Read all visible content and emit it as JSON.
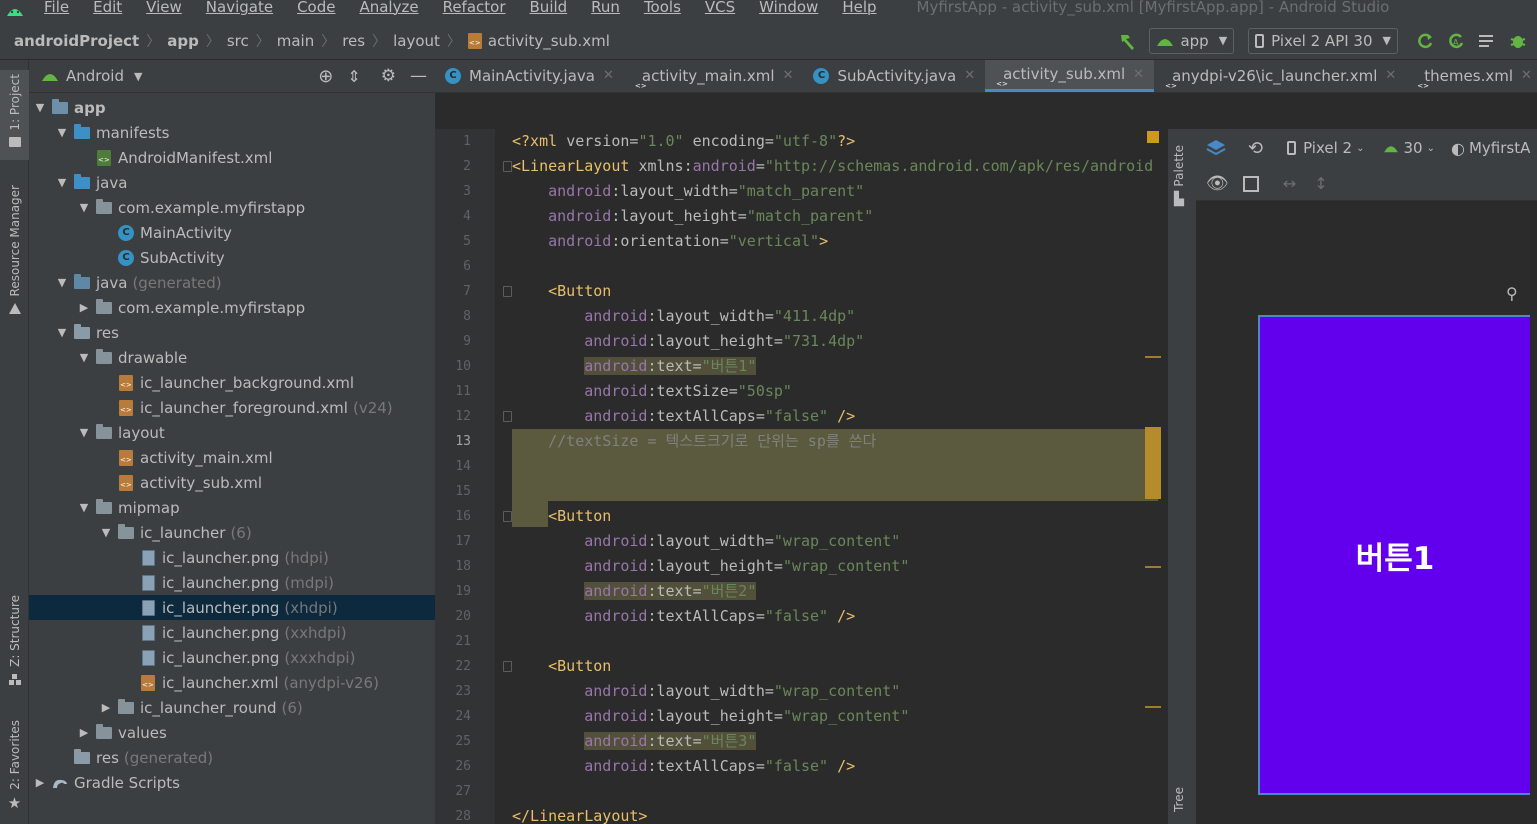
{
  "menubar": {
    "items": [
      "File",
      "Edit",
      "View",
      "Navigate",
      "Code",
      "Analyze",
      "Refactor",
      "Build",
      "Run",
      "Tools",
      "VCS",
      "Window",
      "Help"
    ],
    "title": "MyfirstApp - activity_sub.xml [MyfirstApp.app] - Android Studio"
  },
  "navbar": {
    "crumbs": [
      "androidProject",
      "app",
      "src",
      "main",
      "res",
      "layout",
      "activity_sub.xml"
    ],
    "run_config": "app",
    "device": "Pixel 2 API 30"
  },
  "sidestrip": {
    "project": "1: Project",
    "resource_manager": "Resource Manager",
    "structure": "Z: Structure",
    "favorites": "2: Favorites"
  },
  "project_panel": {
    "view_mode": "Android",
    "tree": [
      {
        "label": "app",
        "indent": 0,
        "expanded": true,
        "icon": "module"
      },
      {
        "label": "manifests",
        "indent": 1,
        "expanded": true,
        "icon": "folder-blue"
      },
      {
        "label": "AndroidManifest.xml",
        "indent": 2,
        "icon": "manifest"
      },
      {
        "label": "java",
        "indent": 1,
        "expanded": true,
        "icon": "folder-blue"
      },
      {
        "label": "com.example.myfirstapp",
        "indent": 2,
        "expanded": true,
        "icon": "folder"
      },
      {
        "label": "MainActivity",
        "indent": 3,
        "icon": "class"
      },
      {
        "label": "SubActivity",
        "indent": 3,
        "icon": "class"
      },
      {
        "label": "java",
        "suffix": "(generated)",
        "indent": 1,
        "expanded": true,
        "icon": "folder-gen"
      },
      {
        "label": "com.example.myfirstapp",
        "indent": 2,
        "expanded": false,
        "icon": "folder"
      },
      {
        "label": "res",
        "indent": 1,
        "expanded": true,
        "icon": "folder-res"
      },
      {
        "label": "drawable",
        "indent": 2,
        "expanded": true,
        "icon": "folder"
      },
      {
        "label": "ic_launcher_background.xml",
        "indent": 3,
        "icon": "xml"
      },
      {
        "label": "ic_launcher_foreground.xml",
        "suffix": "(v24)",
        "indent": 3,
        "icon": "xml"
      },
      {
        "label": "layout",
        "indent": 2,
        "expanded": true,
        "icon": "folder"
      },
      {
        "label": "activity_main.xml",
        "indent": 3,
        "icon": "xml"
      },
      {
        "label": "activity_sub.xml",
        "indent": 3,
        "icon": "xml"
      },
      {
        "label": "mipmap",
        "indent": 2,
        "expanded": true,
        "icon": "folder"
      },
      {
        "label": "ic_launcher",
        "suffix": "(6)",
        "indent": 3,
        "expanded": true,
        "icon": "folder"
      },
      {
        "label": "ic_launcher.png",
        "suffix": "(hdpi)",
        "indent": 4,
        "icon": "png"
      },
      {
        "label": "ic_launcher.png",
        "suffix": "(mdpi)",
        "indent": 4,
        "icon": "png"
      },
      {
        "label": "ic_launcher.png",
        "suffix": "(xhdpi)",
        "indent": 4,
        "icon": "png",
        "selected": true
      },
      {
        "label": "ic_launcher.png",
        "suffix": "(xxhdpi)",
        "indent": 4,
        "icon": "png"
      },
      {
        "label": "ic_launcher.png",
        "suffix": "(xxxhdpi)",
        "indent": 4,
        "icon": "png"
      },
      {
        "label": "ic_launcher.xml",
        "suffix": "(anydpi-v26)",
        "indent": 4,
        "icon": "xml"
      },
      {
        "label": "ic_launcher_round",
        "suffix": "(6)",
        "indent": 3,
        "expanded": false,
        "icon": "folder"
      },
      {
        "label": "values",
        "indent": 2,
        "expanded": false,
        "icon": "folder"
      },
      {
        "label": "res",
        "suffix": "(generated)",
        "indent": 1,
        "icon": "folder-res"
      },
      {
        "label": "Gradle Scripts",
        "indent": 0,
        "expanded": false,
        "icon": "gradle"
      }
    ]
  },
  "tabs": [
    {
      "label": "MainActivity.java",
      "icon": "class"
    },
    {
      "label": "activity_main.xml",
      "icon": "xml"
    },
    {
      "label": "SubActivity.java",
      "icon": "class"
    },
    {
      "label": "activity_sub.xml",
      "icon": "xml",
      "active": true
    },
    {
      "label": "anydpi-v26\\ic_launcher.xml",
      "icon": "xml"
    },
    {
      "label": "themes.xml",
      "icon": "xml"
    }
  ],
  "editor": {
    "current_line": 13,
    "lines": [
      {
        "n": "1",
        "parts": [
          [
            "pi",
            "<?xml "
          ],
          [
            "attr",
            "version="
          ],
          [
            "str",
            "\"1.0\" "
          ],
          [
            "attr",
            "encoding="
          ],
          [
            "str",
            "\"utf-8\""
          ],
          [
            "pi",
            "?>"
          ]
        ]
      },
      {
        "n": "2",
        "parts": [
          [
            "tag",
            "<LinearLayout "
          ],
          [
            "attr",
            "xmlns:"
          ],
          [
            "ns",
            "android"
          ],
          [
            "attr",
            "="
          ],
          [
            "str",
            "\"http://schemas.android.com/apk/res/android\""
          ]
        ]
      },
      {
        "n": "3",
        "parts": [
          [
            "plain",
            "    "
          ],
          [
            "ns",
            "android"
          ],
          [
            "attr",
            ":layout_width="
          ],
          [
            "str",
            "\"match_parent\""
          ]
        ]
      },
      {
        "n": "4",
        "parts": [
          [
            "plain",
            "    "
          ],
          [
            "ns",
            "android"
          ],
          [
            "attr",
            ":layout_height="
          ],
          [
            "str",
            "\"match_parent\""
          ]
        ]
      },
      {
        "n": "5",
        "parts": [
          [
            "plain",
            "    "
          ],
          [
            "ns",
            "android"
          ],
          [
            "attr",
            ":orientation="
          ],
          [
            "str",
            "\"vertical\""
          ],
          [
            "tag",
            ">"
          ]
        ]
      },
      {
        "n": "6",
        "parts": []
      },
      {
        "n": "7",
        "parts": [
          [
            "plain",
            "    "
          ],
          [
            "tag",
            "<Button"
          ]
        ]
      },
      {
        "n": "8",
        "parts": [
          [
            "plain",
            "        "
          ],
          [
            "ns",
            "android"
          ],
          [
            "attr",
            ":layout_width="
          ],
          [
            "str",
            "\"411.4dp\""
          ]
        ]
      },
      {
        "n": "9",
        "parts": [
          [
            "plain",
            "        "
          ],
          [
            "ns",
            "android"
          ],
          [
            "attr",
            ":layout_height="
          ],
          [
            "str",
            "\"731.4dp\""
          ]
        ]
      },
      {
        "n": "10",
        "parts": [
          [
            "plain",
            "        "
          ],
          [
            "hns",
            "android"
          ],
          [
            "hattr",
            ":text="
          ],
          [
            "hstr",
            "\"버튼1\""
          ]
        ]
      },
      {
        "n": "11",
        "parts": [
          [
            "plain",
            "        "
          ],
          [
            "ns",
            "android"
          ],
          [
            "attr",
            ":textSize="
          ],
          [
            "str",
            "\"50sp\""
          ]
        ]
      },
      {
        "n": "12",
        "parts": [
          [
            "plain",
            "        "
          ],
          [
            "ns",
            "android"
          ],
          [
            "attr",
            ":textAllCaps="
          ],
          [
            "str",
            "\"false\" "
          ],
          [
            "tag",
            "/>"
          ]
        ]
      },
      {
        "n": "13",
        "parts": [
          [
            "plain",
            "    "
          ],
          [
            "cmt",
            "//textSize = 텍스트크기로 단위는 sp를 쓴다"
          ]
        ]
      },
      {
        "n": "14",
        "parts": []
      },
      {
        "n": "15",
        "parts": []
      },
      {
        "n": "16",
        "parts": [
          [
            "plain",
            "    "
          ],
          [
            "tag",
            "<Button"
          ]
        ]
      },
      {
        "n": "17",
        "parts": [
          [
            "plain",
            "        "
          ],
          [
            "ns",
            "android"
          ],
          [
            "attr",
            ":layout_width="
          ],
          [
            "str",
            "\"wrap_content\""
          ]
        ]
      },
      {
        "n": "18",
        "parts": [
          [
            "plain",
            "        "
          ],
          [
            "ns",
            "android"
          ],
          [
            "attr",
            ":layout_height="
          ],
          [
            "str",
            "\"wrap_content\""
          ]
        ]
      },
      {
        "n": "19",
        "parts": [
          [
            "plain",
            "        "
          ],
          [
            "hns",
            "android"
          ],
          [
            "hattr",
            ":text="
          ],
          [
            "hstr",
            "\"버튼2\""
          ]
        ]
      },
      {
        "n": "20",
        "parts": [
          [
            "plain",
            "        "
          ],
          [
            "ns",
            "android"
          ],
          [
            "attr",
            ":textAllCaps="
          ],
          [
            "str",
            "\"false\" "
          ],
          [
            "tag",
            "/>"
          ]
        ]
      },
      {
        "n": "21",
        "parts": []
      },
      {
        "n": "22",
        "parts": [
          [
            "plain",
            "    "
          ],
          [
            "tag",
            "<Button"
          ]
        ]
      },
      {
        "n": "23",
        "parts": [
          [
            "plain",
            "        "
          ],
          [
            "ns",
            "android"
          ],
          [
            "attr",
            ":layout_width="
          ],
          [
            "str",
            "\"wrap_content\""
          ]
        ]
      },
      {
        "n": "24",
        "parts": [
          [
            "plain",
            "        "
          ],
          [
            "ns",
            "android"
          ],
          [
            "attr",
            ":layout_height="
          ],
          [
            "str",
            "\"wrap_content\""
          ]
        ]
      },
      {
        "n": "25",
        "parts": [
          [
            "plain",
            "        "
          ],
          [
            "hns",
            "android"
          ],
          [
            "hattr",
            ":text="
          ],
          [
            "hstr",
            "\"버튼3\""
          ]
        ]
      },
      {
        "n": "26",
        "parts": [
          [
            "plain",
            "        "
          ],
          [
            "ns",
            "android"
          ],
          [
            "attr",
            ":textAllCaps="
          ],
          [
            "str",
            "\"false\" "
          ],
          [
            "tag",
            "/>"
          ]
        ]
      },
      {
        "n": "27",
        "parts": []
      },
      {
        "n": "28",
        "parts": [
          [
            "tag",
            "</LinearLayout>"
          ]
        ]
      }
    ]
  },
  "palette_strip": {
    "palette": "Palette",
    "tree": "Tree"
  },
  "design": {
    "device": "Pixel 2",
    "api": "30",
    "theme": "MyfirstA",
    "preview_button_text": "버튼1"
  },
  "colors": {
    "accent": "#4a88c7",
    "button_purple": "#6200ee",
    "selection": "#0d293e"
  }
}
